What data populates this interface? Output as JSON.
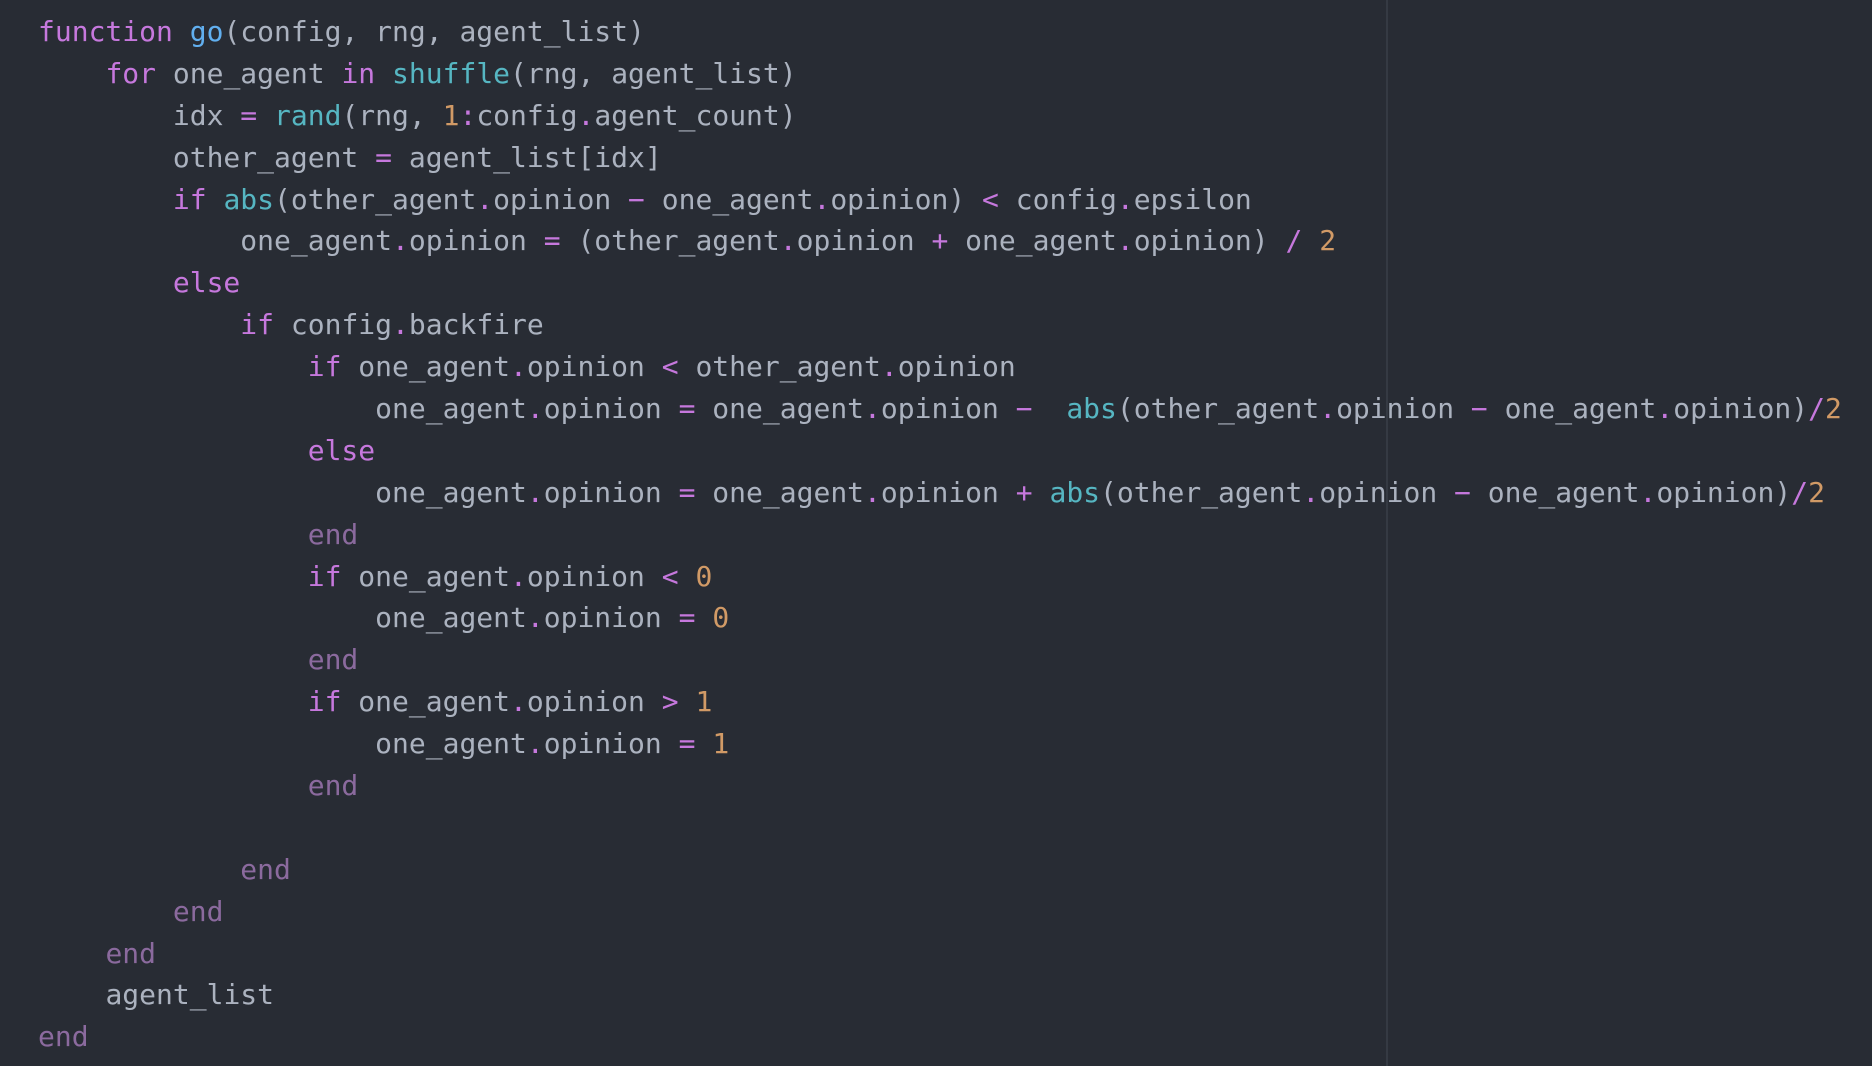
{
  "editor": {
    "theme_colors": {
      "background": "#282c34",
      "text": "#abb2bf",
      "keyword": "#c678dd",
      "function_name": "#61afef",
      "builtin": "#56b6c2",
      "number": "#d19a66",
      "end_keyword": "#8b6a9e",
      "wrap_guide": "#353a43"
    },
    "lines": [
      {
        "indent": "",
        "tokens": [
          {
            "t": "kw",
            "v": "function"
          },
          {
            "t": "plain",
            "v": " "
          },
          {
            "t": "fn",
            "v": "go"
          },
          {
            "t": "plain",
            "v": "(config, rng, agent_list)"
          }
        ]
      },
      {
        "indent": "    ",
        "tokens": [
          {
            "t": "kw",
            "v": "for"
          },
          {
            "t": "plain",
            "v": " one_agent "
          },
          {
            "t": "kw",
            "v": "in"
          },
          {
            "t": "plain",
            "v": " "
          },
          {
            "t": "builtin",
            "v": "shuffle"
          },
          {
            "t": "plain",
            "v": "(rng, agent_list)"
          }
        ]
      },
      {
        "indent": "        ",
        "tokens": [
          {
            "t": "plain",
            "v": "idx "
          },
          {
            "t": "op",
            "v": "="
          },
          {
            "t": "plain",
            "v": " "
          },
          {
            "t": "builtin",
            "v": "rand"
          },
          {
            "t": "plain",
            "v": "(rng, "
          },
          {
            "t": "num",
            "v": "1"
          },
          {
            "t": "op",
            "v": ":"
          },
          {
            "t": "plain",
            "v": "config"
          },
          {
            "t": "op",
            "v": "."
          },
          {
            "t": "plain",
            "v": "agent_count)"
          }
        ]
      },
      {
        "indent": "        ",
        "tokens": [
          {
            "t": "plain",
            "v": "other_agent "
          },
          {
            "t": "op",
            "v": "="
          },
          {
            "t": "plain",
            "v": " agent_list[idx]"
          }
        ]
      },
      {
        "indent": "        ",
        "tokens": [
          {
            "t": "kw",
            "v": "if"
          },
          {
            "t": "plain",
            "v": " "
          },
          {
            "t": "builtin",
            "v": "abs"
          },
          {
            "t": "plain",
            "v": "(other_agent"
          },
          {
            "t": "op",
            "v": "."
          },
          {
            "t": "plain",
            "v": "opinion "
          },
          {
            "t": "op",
            "v": "−"
          },
          {
            "t": "plain",
            "v": " one_agent"
          },
          {
            "t": "op",
            "v": "."
          },
          {
            "t": "plain",
            "v": "opinion) "
          },
          {
            "t": "op",
            "v": "<"
          },
          {
            "t": "plain",
            "v": " config"
          },
          {
            "t": "op",
            "v": "."
          },
          {
            "t": "plain",
            "v": "epsilon"
          }
        ]
      },
      {
        "indent": "            ",
        "tokens": [
          {
            "t": "plain",
            "v": "one_agent"
          },
          {
            "t": "op",
            "v": "."
          },
          {
            "t": "plain",
            "v": "opinion "
          },
          {
            "t": "op",
            "v": "="
          },
          {
            "t": "plain",
            "v": " (other_agent"
          },
          {
            "t": "op",
            "v": "."
          },
          {
            "t": "plain",
            "v": "opinion "
          },
          {
            "t": "op",
            "v": "+"
          },
          {
            "t": "plain",
            "v": " one_agent"
          },
          {
            "t": "op",
            "v": "."
          },
          {
            "t": "plain",
            "v": "opinion) "
          },
          {
            "t": "op",
            "v": "/"
          },
          {
            "t": "plain",
            "v": " "
          },
          {
            "t": "num",
            "v": "2"
          }
        ]
      },
      {
        "indent": "        ",
        "tokens": [
          {
            "t": "kw",
            "v": "else"
          }
        ]
      },
      {
        "indent": "            ",
        "tokens": [
          {
            "t": "kw",
            "v": "if"
          },
          {
            "t": "plain",
            "v": " config"
          },
          {
            "t": "op",
            "v": "."
          },
          {
            "t": "plain",
            "v": "backfire"
          }
        ]
      },
      {
        "indent": "                ",
        "tokens": [
          {
            "t": "kw",
            "v": "if"
          },
          {
            "t": "plain",
            "v": " one_agent"
          },
          {
            "t": "op",
            "v": "."
          },
          {
            "t": "plain",
            "v": "opinion "
          },
          {
            "t": "op",
            "v": "<"
          },
          {
            "t": "plain",
            "v": " other_agent"
          },
          {
            "t": "op",
            "v": "."
          },
          {
            "t": "plain",
            "v": "opinion"
          }
        ]
      },
      {
        "indent": "                    ",
        "tokens": [
          {
            "t": "plain",
            "v": "one_agent"
          },
          {
            "t": "op",
            "v": "."
          },
          {
            "t": "plain",
            "v": "opinion "
          },
          {
            "t": "op",
            "v": "="
          },
          {
            "t": "plain",
            "v": " one_agent"
          },
          {
            "t": "op",
            "v": "."
          },
          {
            "t": "plain",
            "v": "opinion "
          },
          {
            "t": "op",
            "v": "−"
          },
          {
            "t": "plain",
            "v": "  "
          },
          {
            "t": "builtin",
            "v": "abs"
          },
          {
            "t": "plain",
            "v": "(other_agent"
          },
          {
            "t": "op",
            "v": "."
          },
          {
            "t": "plain",
            "v": "opinion "
          },
          {
            "t": "op",
            "v": "−"
          },
          {
            "t": "plain",
            "v": " one_agent"
          },
          {
            "t": "op",
            "v": "."
          },
          {
            "t": "plain",
            "v": "opinion)"
          },
          {
            "t": "op",
            "v": "/"
          },
          {
            "t": "num",
            "v": "2"
          }
        ]
      },
      {
        "indent": "                ",
        "tokens": [
          {
            "t": "kw",
            "v": "else"
          }
        ]
      },
      {
        "indent": "                    ",
        "tokens": [
          {
            "t": "plain",
            "v": "one_agent"
          },
          {
            "t": "op",
            "v": "."
          },
          {
            "t": "plain",
            "v": "opinion "
          },
          {
            "t": "op",
            "v": "="
          },
          {
            "t": "plain",
            "v": " one_agent"
          },
          {
            "t": "op",
            "v": "."
          },
          {
            "t": "plain",
            "v": "opinion "
          },
          {
            "t": "op",
            "v": "+"
          },
          {
            "t": "plain",
            "v": " "
          },
          {
            "t": "builtin",
            "v": "abs"
          },
          {
            "t": "plain",
            "v": "(other_agent"
          },
          {
            "t": "op",
            "v": "."
          },
          {
            "t": "plain",
            "v": "opinion "
          },
          {
            "t": "op",
            "v": "−"
          },
          {
            "t": "plain",
            "v": " one_agent"
          },
          {
            "t": "op",
            "v": "."
          },
          {
            "t": "plain",
            "v": "opinion)"
          },
          {
            "t": "op",
            "v": "/"
          },
          {
            "t": "num",
            "v": "2"
          }
        ]
      },
      {
        "indent": "                ",
        "tokens": [
          {
            "t": "end",
            "v": "end"
          }
        ]
      },
      {
        "indent": "                ",
        "tokens": [
          {
            "t": "kw",
            "v": "if"
          },
          {
            "t": "plain",
            "v": " one_agent"
          },
          {
            "t": "op",
            "v": "."
          },
          {
            "t": "plain",
            "v": "opinion "
          },
          {
            "t": "op",
            "v": "<"
          },
          {
            "t": "plain",
            "v": " "
          },
          {
            "t": "num",
            "v": "0"
          }
        ]
      },
      {
        "indent": "                    ",
        "tokens": [
          {
            "t": "plain",
            "v": "one_agent"
          },
          {
            "t": "op",
            "v": "."
          },
          {
            "t": "plain",
            "v": "opinion "
          },
          {
            "t": "op",
            "v": "="
          },
          {
            "t": "plain",
            "v": " "
          },
          {
            "t": "num",
            "v": "0"
          }
        ]
      },
      {
        "indent": "                ",
        "tokens": [
          {
            "t": "end",
            "v": "end"
          }
        ]
      },
      {
        "indent": "                ",
        "tokens": [
          {
            "t": "kw",
            "v": "if"
          },
          {
            "t": "plain",
            "v": " one_agent"
          },
          {
            "t": "op",
            "v": "."
          },
          {
            "t": "plain",
            "v": "opinion "
          },
          {
            "t": "op",
            "v": ">"
          },
          {
            "t": "plain",
            "v": " "
          },
          {
            "t": "num",
            "v": "1"
          }
        ]
      },
      {
        "indent": "                    ",
        "tokens": [
          {
            "t": "plain",
            "v": "one_agent"
          },
          {
            "t": "op",
            "v": "."
          },
          {
            "t": "plain",
            "v": "opinion "
          },
          {
            "t": "op",
            "v": "="
          },
          {
            "t": "plain",
            "v": " "
          },
          {
            "t": "num",
            "v": "1"
          }
        ]
      },
      {
        "indent": "                ",
        "tokens": [
          {
            "t": "end",
            "v": "end"
          }
        ]
      },
      {
        "indent": "",
        "tokens": []
      },
      {
        "indent": "            ",
        "tokens": [
          {
            "t": "end",
            "v": "end"
          }
        ]
      },
      {
        "indent": "        ",
        "tokens": [
          {
            "t": "end",
            "v": "end"
          }
        ]
      },
      {
        "indent": "    ",
        "tokens": [
          {
            "t": "end",
            "v": "end"
          }
        ]
      },
      {
        "indent": "    ",
        "tokens": [
          {
            "t": "plain",
            "v": "agent_list"
          }
        ]
      },
      {
        "indent": "",
        "tokens": [
          {
            "t": "end",
            "v": "end"
          }
        ]
      }
    ]
  }
}
